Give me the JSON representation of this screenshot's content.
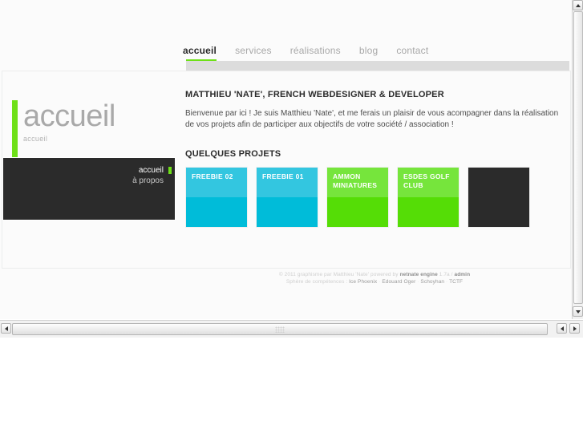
{
  "nav": {
    "items": [
      {
        "label": "accueil",
        "active": true
      },
      {
        "label": "services",
        "active": false
      },
      {
        "label": "réalisations",
        "active": false
      },
      {
        "label": "blog",
        "active": false
      },
      {
        "label": "contact",
        "active": false
      }
    ]
  },
  "left": {
    "title": "accueil",
    "subtitle": "accueil",
    "menu": [
      {
        "label": "accueil",
        "active": true
      },
      {
        "label": "à propos",
        "active": false
      }
    ]
  },
  "main": {
    "intro_title": "MATTHIEU 'NATE', FRENCH WEBDESIGNER & DEVELOPER",
    "intro_text": "Bienvenue par ici ! Je suis Matthieu 'Nate', et me ferais un plaisir de vous acompagner dans la réalisation de vos projets afin de participer aux objectifs de votre société / association !",
    "projects_title": "QUELQUES PROJETS",
    "projects": [
      {
        "label": "FREEBIE 02",
        "color_top": "#33c6e0",
        "color_bottom": "#00bcd9"
      },
      {
        "label": "FREEBIE 01",
        "color_top": "#33c6e0",
        "color_bottom": "#00bcd9"
      },
      {
        "label": "AMMON MINIATURES",
        "color_top": "#76e53c",
        "color_bottom": "#55dd06"
      },
      {
        "label": "ESDES GOLF CLUB",
        "color_top": "#76e53c",
        "color_bottom": "#55dd06"
      },
      {
        "label": "",
        "color_top": "#2b2b2b",
        "color_bottom": "#2b2b2b"
      }
    ]
  },
  "footer": {
    "line1_pre": "© 2011 graphisme par Matthieu 'Nate' powered by ",
    "line1_engine": "netnate engine",
    "line1_version": " 1.7a / ",
    "line1_admin": "admin",
    "line2_pre": "Sphère de compétences : ",
    "line2_links": [
      "Ice Phoenix",
      "Edouard Oger",
      "Schoyhan",
      "TCTF"
    ],
    "line2_sep": " · "
  },
  "colors": {
    "accent_green": "#6ee018",
    "dark": "#2b2b2b",
    "cyan": "#00bcd9"
  }
}
